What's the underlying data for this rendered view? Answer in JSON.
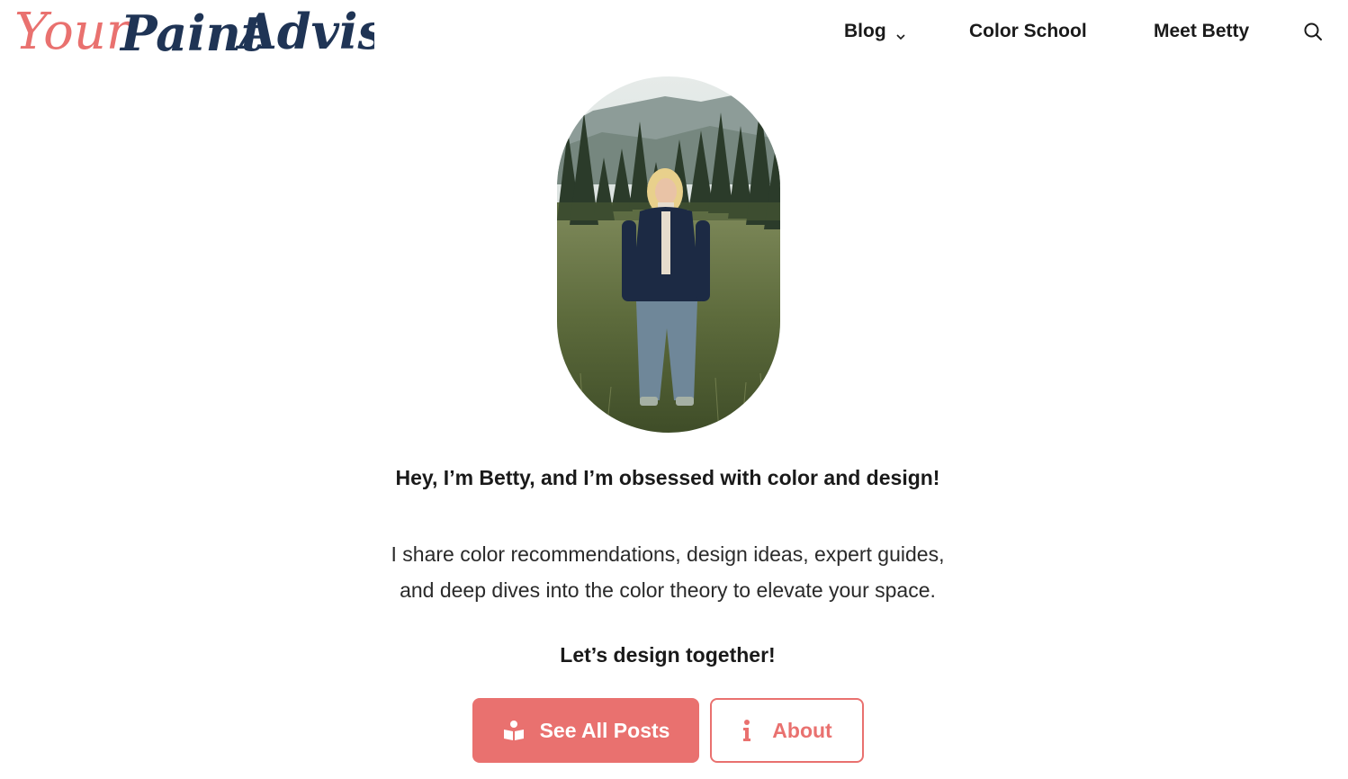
{
  "header": {
    "logo": {
      "word1": "Your",
      "word2": "Paint",
      "word3": "Advisor"
    },
    "nav": {
      "blog_label": "Blog",
      "blog_icon": "chevron-down-icon",
      "color_school_label": "Color School",
      "meet_betty_label": "Meet Betty",
      "search_icon": "search-icon"
    }
  },
  "hero": {
    "image_alt": "Portrait of Betty standing in a grassy meadow with pine trees",
    "headline": "Hey, I’m Betty, and I’m obsessed with color and design!",
    "intro_line1": "I share color recommendations, design ideas, expert guides,",
    "intro_line2": "and deep dives into the color theory to elevate your space.",
    "cta_heading": "Let’s design together!"
  },
  "buttons": {
    "see_all_posts_label": "See All Posts",
    "see_all_posts_icon": "reader-icon",
    "about_label": "About",
    "about_icon": "info-icon"
  },
  "colors": {
    "accent": "#e9716f",
    "brand_navy": "#1f3455",
    "text": "#1a1a1a"
  }
}
